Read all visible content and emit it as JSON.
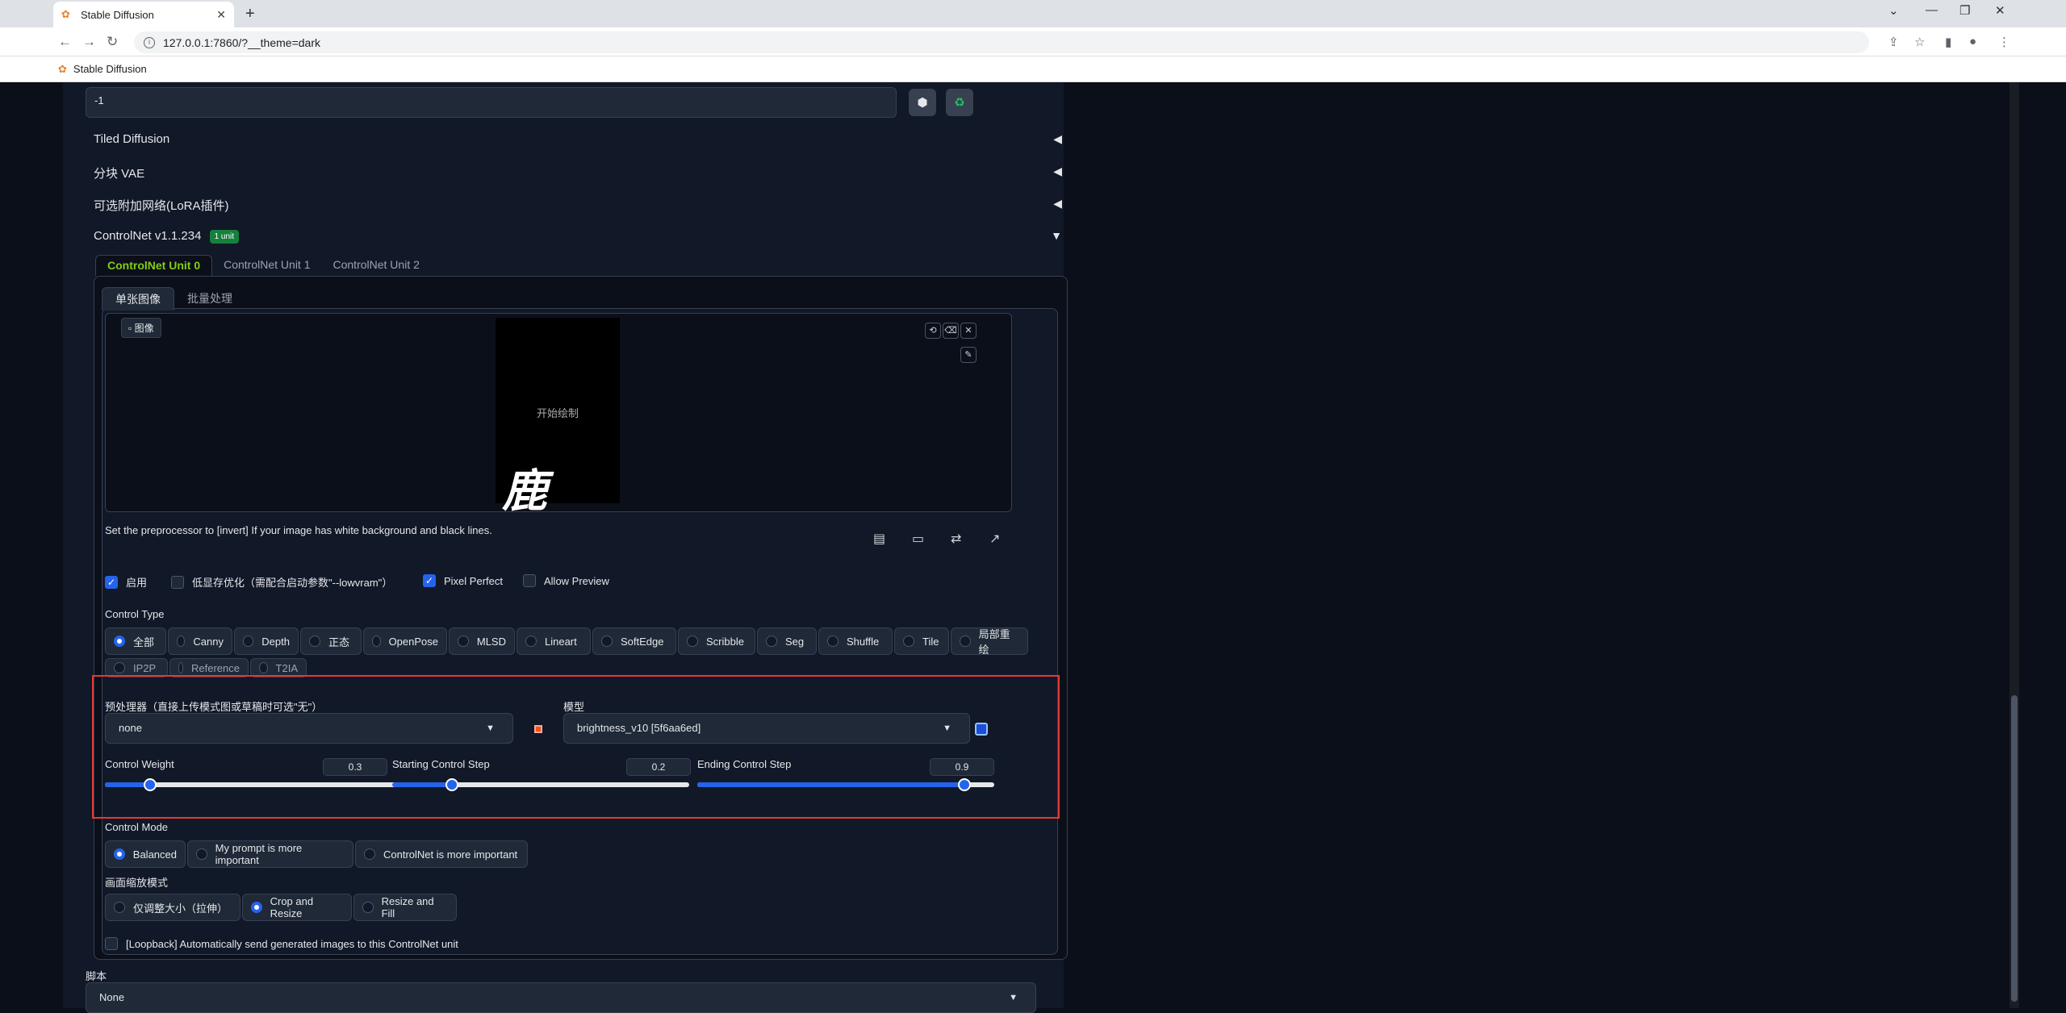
{
  "browser": {
    "tab_title": "Stable Diffusion",
    "url": "127.0.0.1:7860/?__theme=dark",
    "bookmark": "Stable Diffusion",
    "new_tab": "+",
    "close": "✕"
  },
  "seed": {
    "value": "-1"
  },
  "accordions": {
    "tiled_diffusion": "Tiled Diffusion",
    "tiled_vae": "分块 VAE",
    "lora": "可选附加网络(LoRA插件)",
    "controlnet": "ControlNet v1.1.234",
    "controlnet_badge": "1 unit"
  },
  "units": [
    "ControlNet Unit 0",
    "ControlNet Unit 1",
    "ControlNet Unit 2"
  ],
  "mode_tabs": [
    "单张图像",
    "批量处理"
  ],
  "image": {
    "label": "图像",
    "canvas_hint": "开始绘制",
    "brush_text": "鹿"
  },
  "note": "Set the preprocessor to [invert] If your image has white background and black lines.",
  "checks": {
    "enable": "启用",
    "lowvram": "低显存优化（需配合启动参数\"--lowvram\"）",
    "pixel_perfect": "Pixel Perfect",
    "allow_preview": "Allow Preview"
  },
  "control_type": {
    "label": "Control Type",
    "options": [
      "全部",
      "Canny",
      "Depth",
      "正态",
      "OpenPose",
      "MLSD",
      "Lineart",
      "SoftEdge",
      "Scribble",
      "Seg",
      "Shuffle",
      "Tile",
      "局部重绘"
    ],
    "options2": [
      "IP2P",
      "Reference",
      "T2IA"
    ],
    "selected": "全部"
  },
  "preprocessor": {
    "label": "预处理器（直接上传模式图或草稿时可选\"无\"）",
    "value": "none"
  },
  "model": {
    "label": "模型",
    "value": "brightness_v10 [5f6aa6ed]"
  },
  "sliders": {
    "weight": {
      "label": "Control Weight",
      "value": "0.3",
      "fraction": 0.15
    },
    "start": {
      "label": "Starting Control Step",
      "value": "0.2",
      "fraction": 0.2
    },
    "end": {
      "label": "Ending Control Step",
      "value": "0.9",
      "fraction": 0.9
    }
  },
  "control_mode": {
    "label": "Control Mode",
    "options": [
      "Balanced",
      "My prompt is more important",
      "ControlNet is more important"
    ]
  },
  "resize_mode": {
    "label": "画面缩放模式",
    "options": [
      "仅调整大小（拉伸）",
      "Crop and Resize",
      "Resize and Fill"
    ]
  },
  "loopback": "[Loopback] Automatically send generated images to this ControlNet unit",
  "script": {
    "label": "脚本",
    "value": "None"
  }
}
